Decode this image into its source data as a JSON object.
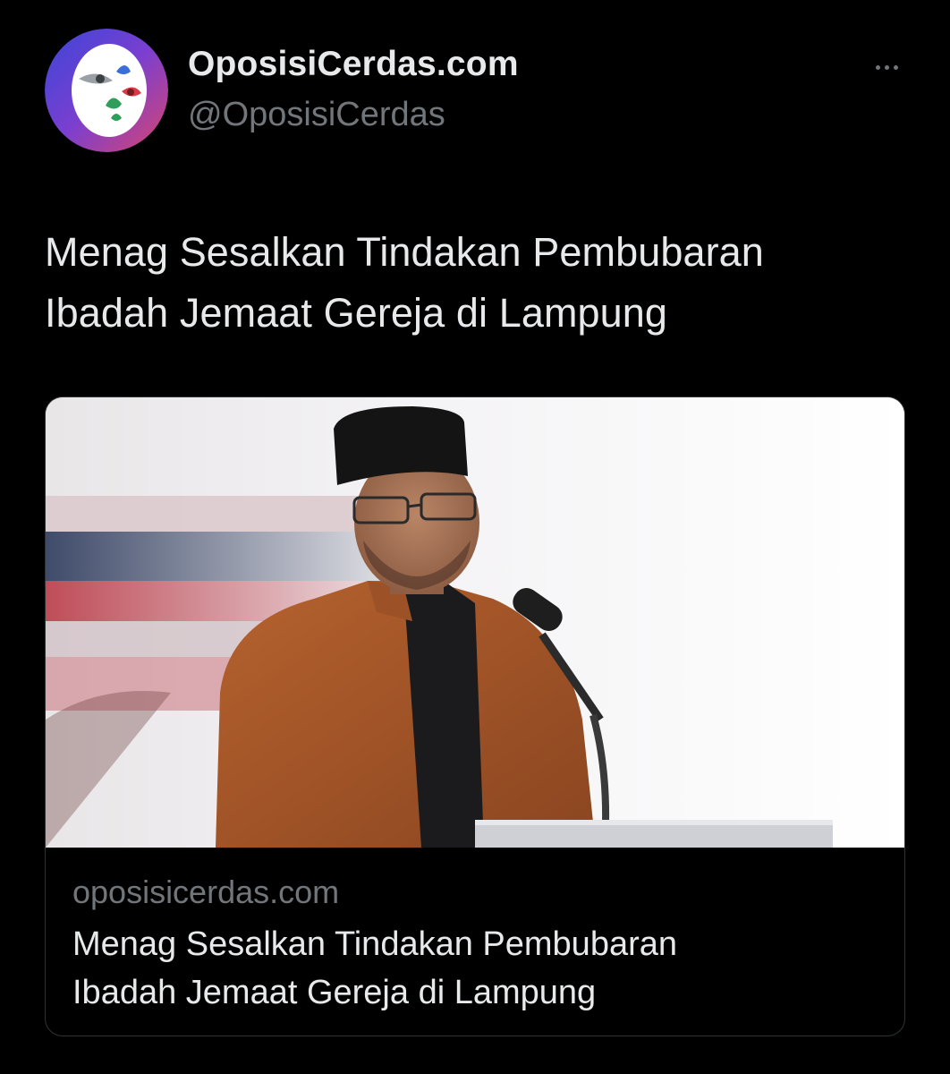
{
  "author": {
    "display_name": "OposisiCerdas.com",
    "handle": "@OposisiCerdas",
    "avatar_icon": "oposisicerdas-logo-icon"
  },
  "more_icon": "more-horizontal-icon",
  "tweet": {
    "text_line_1": "Menag Sesalkan Tindakan Pembubaran",
    "text_line_2": "Ibadah Jemaat Gereja di Lampung"
  },
  "card": {
    "image_subject": "man-in-black-peci-speaking-at-podium-photo",
    "domain": "oposisicerdas.com",
    "title_line_1": "Menag Sesalkan Tindakan Pembubaran",
    "title_line_2": "Ibadah Jemaat Gereja di Lampung"
  },
  "colors": {
    "background": "#000000",
    "primary_text": "#e7e9ea",
    "secondary_text": "#71767b",
    "card_border": "#2f3336"
  }
}
